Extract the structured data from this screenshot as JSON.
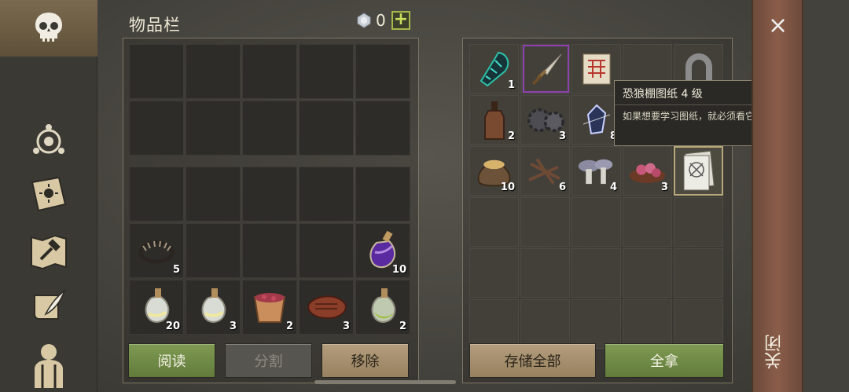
{
  "window": {
    "title": "物品栏"
  },
  "currency": {
    "amount": "0",
    "plus": "+",
    "icon": "gem-icon"
  },
  "sidebar": {
    "items": [
      "skull-icon",
      "compass-icon",
      "sun-book-icon",
      "hammer-map-icon",
      "scroll-quill-icon",
      "character-icon"
    ]
  },
  "inventory": {
    "upper_rows": 2,
    "cols": 5,
    "lower": [
      [
        null,
        null,
        null,
        null,
        null
      ],
      [
        {
          "icon": "bear-trap-icon",
          "count": "5"
        },
        null,
        null,
        null,
        {
          "icon": "purple-potion-icon",
          "count": "10"
        }
      ],
      [
        {
          "icon": "white-potion-icon",
          "count": "20"
        },
        {
          "icon": "white-potion-icon",
          "count": "3"
        },
        {
          "icon": "berry-bucket-icon",
          "count": "2"
        },
        {
          "icon": "steak-icon",
          "count": "3"
        },
        {
          "icon": "green-potion-icon",
          "count": "2"
        }
      ]
    ]
  },
  "storage": {
    "rows": [
      [
        {
          "icon": "crystal-club-icon",
          "count": "1"
        },
        {
          "icon": "dagger-icon",
          "count": ""
        },
        {
          "icon": "blueprint-scroll-icon",
          "count": ""
        },
        null,
        {
          "icon": "horseshoe-icon",
          "count": ""
        }
      ],
      [
        {
          "icon": "bottle-icon",
          "count": "2"
        },
        {
          "icon": "gear-icon",
          "count": "3"
        },
        {
          "icon": "crystal-icon",
          "count": "8"
        },
        null,
        null
      ],
      [
        {
          "icon": "sack-icon",
          "count": "10"
        },
        {
          "icon": "nails-icon",
          "count": "6"
        },
        {
          "icon": "mushroom-icon",
          "count": "4"
        },
        {
          "icon": "meat-bowl-icon",
          "count": "3"
        },
        {
          "icon": "blueprint-paper-icon",
          "count": ""
        }
      ],
      [
        null,
        null,
        null,
        null,
        null
      ],
      [
        null,
        null,
        null,
        null,
        null
      ],
      [
        null,
        null,
        null,
        null,
        null
      ]
    ]
  },
  "tooltip": {
    "title": "恐狼棚图纸 4 级",
    "desc": "如果想要学习图纸，就必须看它。"
  },
  "buttons": {
    "read": "阅读",
    "split": "分割",
    "remove": "移除",
    "store_all": "存储全部",
    "take_all": "全拿"
  },
  "close": {
    "label": "关闭",
    "x": "×"
  },
  "colors": {
    "accent_green": "#7e9a52",
    "tan": "#b39d7c",
    "close_red": "#8a5d49"
  }
}
